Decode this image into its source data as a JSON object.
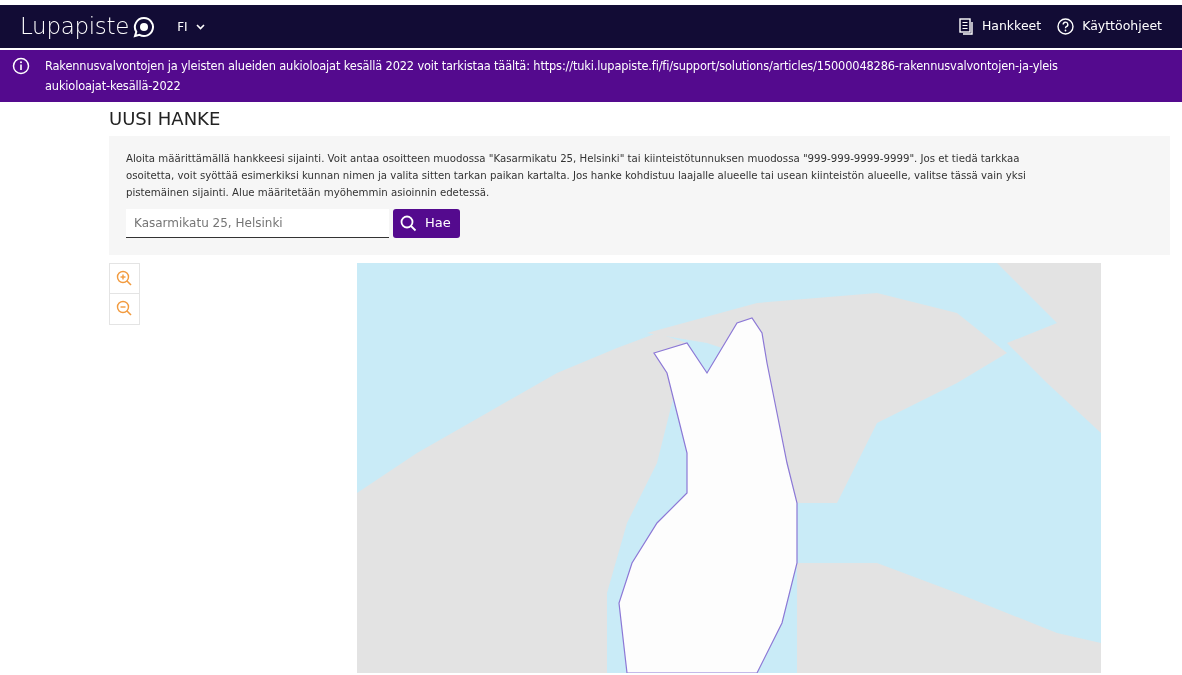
{
  "navbar": {
    "logo": "Lupapiste",
    "language": "FI",
    "links": [
      {
        "kind": "projects",
        "label": "Hankkeet"
      },
      {
        "kind": "help",
        "label": "Käyttöohjeet"
      }
    ]
  },
  "banner": {
    "lines": [
      "Rakennusvalvontojen ja yleisten alueiden aukioloajat kesällä 2022 voit tarkistaa täältä: https://tuki.lupapiste.fi/fi/support/solutions/articles/15000048286-rakennusvalvontojen-ja-yleis",
      "aukioloajat-kesällä-2022"
    ]
  },
  "page": {
    "title": "UUSI HANKE",
    "instructions": "Aloita määrittämällä hankkeesi sijainti. Voit antaa osoitteen muodossa \"Kasarmikatu 25, Helsinki\" tai kiinteistötunnuksen muodossa \"999-999-9999-9999\". Jos et tiedä tarkkaa osoitetta, voit syöttää esimerkiksi kunnan nimen ja valita sitten tarkan paikan kartalta. Jos hanke kohdistuu laajalle alueelle tai usean kiinteistön alueelle, valitse tässä vain yksi pistemäinen sijainti. Alue määritetään myöhemmin asioinnin edetessä.",
    "search": {
      "placeholder": "Kasarmikatu 25, Helsinki",
      "button": "Hae"
    }
  }
}
